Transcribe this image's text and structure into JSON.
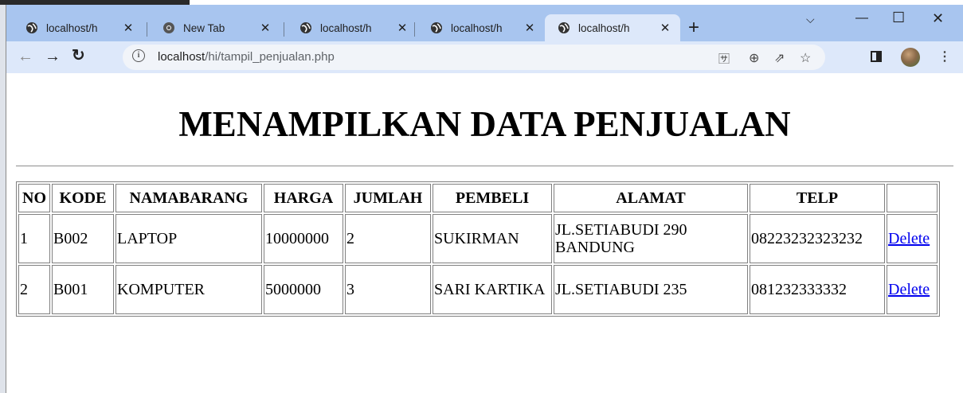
{
  "browser": {
    "tabs": [
      {
        "title": "localhost/h",
        "favicon": "globe-icon"
      },
      {
        "title": "New Tab",
        "favicon": "chrome-icon"
      },
      {
        "title": "localhost/h",
        "favicon": "globe-icon"
      },
      {
        "title": "localhost/h",
        "favicon": "globe-icon"
      },
      {
        "title": "localhost/h",
        "favicon": "globe-icon",
        "active": true
      }
    ],
    "url_host": "localhost",
    "url_path": "/hi/tampil_penjualan.php"
  },
  "page": {
    "heading": "MENAMPILKAN DATA PENJUALAN",
    "table": {
      "headers": [
        "NO",
        "KODE",
        "NAMABARANG",
        "HARGA",
        "JUMLAH",
        "PEMBELI",
        "ALAMAT",
        "TELP",
        ""
      ],
      "rows": [
        {
          "no": "1",
          "kode": "B002",
          "nama": "LAPTOP",
          "harga": "10000000",
          "jumlah": "2",
          "pembeli": "SUKIRMAN",
          "alamat": "JL.SETIABUDI 290 BANDUNG",
          "telp": "08223232323232",
          "action": "Delete"
        },
        {
          "no": "2",
          "kode": "B001",
          "nama": "KOMPUTER",
          "harga": "5000000",
          "jumlah": "3",
          "pembeli": "SARI KARTIKA",
          "alamat": "JL.SETIABUDI 235",
          "telp": "081232333332",
          "action": "Delete"
        }
      ]
    }
  },
  "colors": {
    "tabstrip": "#a8c5ef",
    "active_tab": "#dde8fa",
    "link": "#0000ee"
  }
}
